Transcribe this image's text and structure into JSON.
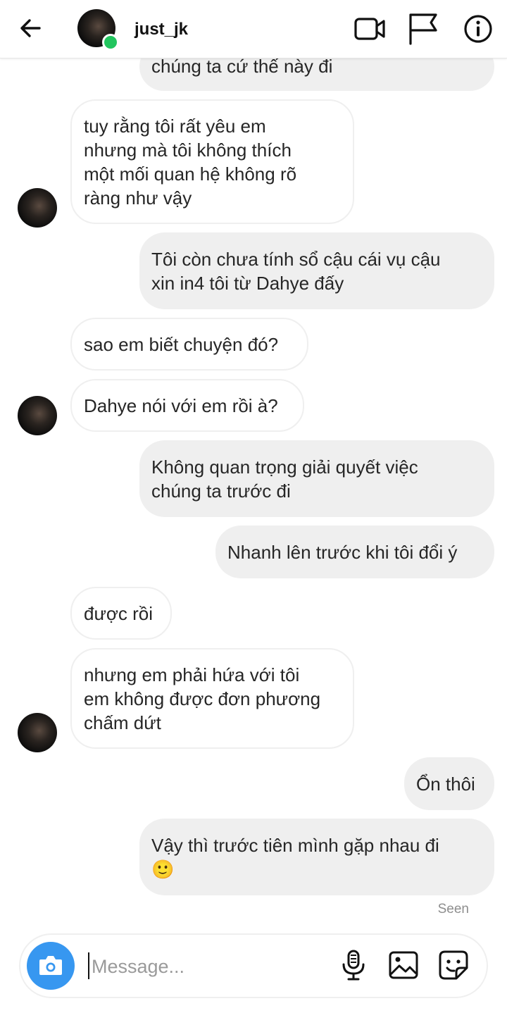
{
  "header": {
    "username": "just_jk",
    "online": true,
    "back_icon": "arrow-left-icon",
    "video_icon": "video-camera-icon",
    "flag_icon": "flag-icon",
    "info_icon": "info-icon"
  },
  "messages": [
    {
      "from": "me",
      "text": "chúng ta cứ thế này đi"
    },
    {
      "from": "them",
      "text": "tuy rằng tôi rất yêu em\nnhưng mà tôi không thích\nmột mối quan hệ không rõ\nràng như vậy"
    },
    {
      "from": "me",
      "text": "Tôi còn chưa tính sổ cậu cái vụ cậu\nxin in4 tôi từ Dahye đấy"
    },
    {
      "from": "them",
      "text": "sao em biết chuyện đó?"
    },
    {
      "from": "them",
      "text": "Dahye nói với em rồi à?"
    },
    {
      "from": "me",
      "text": "Không quan trọng giải quyết việc\nchúng ta trước đi"
    },
    {
      "from": "me",
      "text": "Nhanh lên trước khi tôi đổi ý"
    },
    {
      "from": "them",
      "text": "được rồi"
    },
    {
      "from": "them",
      "text": "nhưng em phải hứa với tôi\nem không được đơn phương\nchấm dứt"
    },
    {
      "from": "me",
      "text": "Ổn thôi"
    },
    {
      "from": "me",
      "text": "Vậy thì trước tiên mình gặp nhau đi\n🙂"
    }
  ],
  "status": {
    "seen": "Seen"
  },
  "composer": {
    "placeholder": "Message...",
    "value": "",
    "camera_icon": "camera-icon",
    "mic_icon": "microphone-icon",
    "gallery_icon": "image-icon",
    "sticker_icon": "sticker-icon"
  },
  "colors": {
    "accent": "#3797f0",
    "online": "#22c55e",
    "outgoing_bubble": "#efefef",
    "incoming_border": "#efefef",
    "seen_text": "#8e8e8e"
  }
}
